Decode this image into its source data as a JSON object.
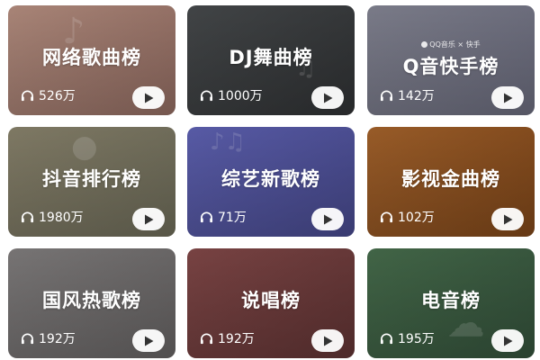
{
  "cards": [
    {
      "title": "网络歌曲榜",
      "plays": "526万",
      "bg": "#a37e73"
    },
    {
      "title": "DJ舞曲榜",
      "plays": "1000万",
      "bg": "#3c3e40"
    },
    {
      "title": "Q音快手榜",
      "plays": "142万",
      "bg": "#767786",
      "logo_text": "QQ音乐 × 快手"
    },
    {
      "title": "抖音排行榜",
      "plays": "1980万",
      "bg": "#7b7863"
    },
    {
      "title": "综艺新歌榜",
      "plays": "71万",
      "bg": "#52549c"
    },
    {
      "title": "影视金曲榜",
      "plays": "102万",
      "bg": "#91521f"
    },
    {
      "title": "国风热歌榜",
      "plays": "192万",
      "bg": "#757272"
    },
    {
      "title": "说唱榜",
      "plays": "192万",
      "bg": "#733f3f"
    },
    {
      "title": "电音榜",
      "plays": "195万",
      "bg": "#3d5c42"
    }
  ],
  "icons": {
    "plays": "headphones-icon",
    "play": "play-icon"
  }
}
